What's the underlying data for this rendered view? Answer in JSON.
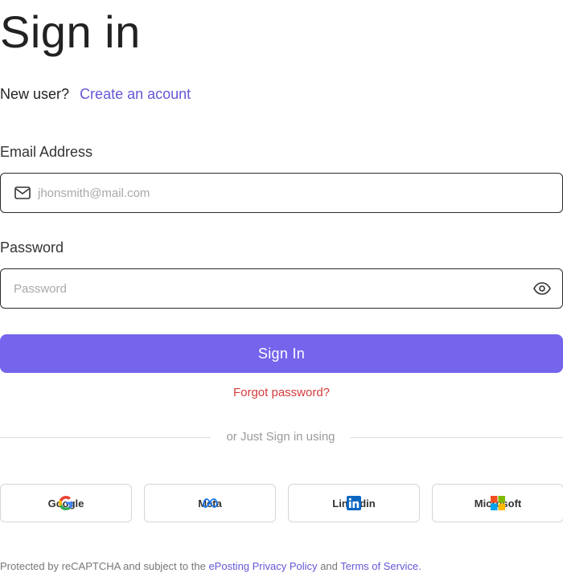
{
  "page": {
    "title": "Sign in"
  },
  "signup": {
    "prompt": "New user?",
    "link": "Create an acount"
  },
  "email": {
    "label": "Email Address",
    "placeholder": "jhonsmith@mail.com",
    "value": ""
  },
  "password": {
    "label": "Password",
    "placeholder": "Password",
    "value": ""
  },
  "actions": {
    "sign_in": "Sign In",
    "forgot": "Forgot password?"
  },
  "divider": {
    "text": "or Just Sign in using"
  },
  "social": [
    {
      "label": "Google",
      "icon": "google-icon"
    },
    {
      "label": "Meta",
      "icon": "meta-icon"
    },
    {
      "label": "Linkedin",
      "icon": "linkedin-icon"
    },
    {
      "label": "Microsoft",
      "icon": "microsoft-icon"
    }
  ],
  "footer": {
    "prefix": "Protected by reCAPTCHA and subject to the",
    "privacy": "ePosting Privacy Policy",
    "and": "and",
    "terms": "Terms of Service."
  },
  "colors": {
    "accent": "#7465ec",
    "link": "#6457d6",
    "danger": "#d33c3c"
  }
}
